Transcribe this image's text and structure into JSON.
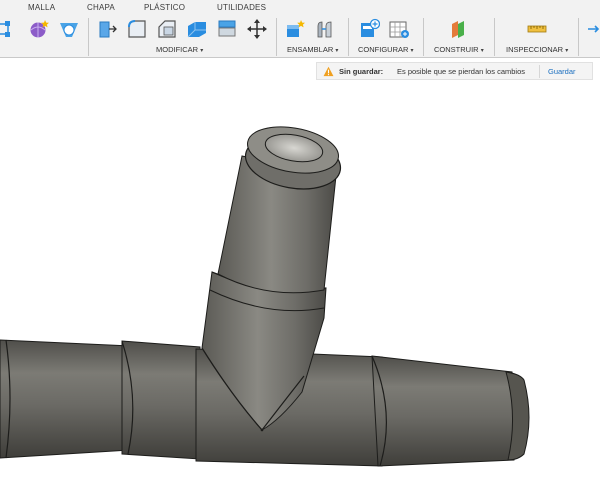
{
  "tabs": [
    "MALLA",
    "CHAPA",
    "PLÁSTICO",
    "UTILIDADES"
  ],
  "toolbar": {
    "groups": {
      "modificar": "MODIFICAR",
      "ensamblar": "ENSAMBLAR",
      "configurar": "CONFIGURAR",
      "construir": "CONSTRUIR",
      "inspeccionar": "INSPECCIONAR"
    },
    "caret": "▾"
  },
  "banner": {
    "label": "Sin guardar:",
    "message": "Es posible que se pierdan los cambios",
    "save": "Guardar"
  },
  "colors": {
    "toolbar_bg": "#f2f2f2",
    "accent_blue": "#2a8de0",
    "save_link": "#1b6fbf",
    "warning": "#f0a020",
    "model_gray": "#6f6e69"
  }
}
